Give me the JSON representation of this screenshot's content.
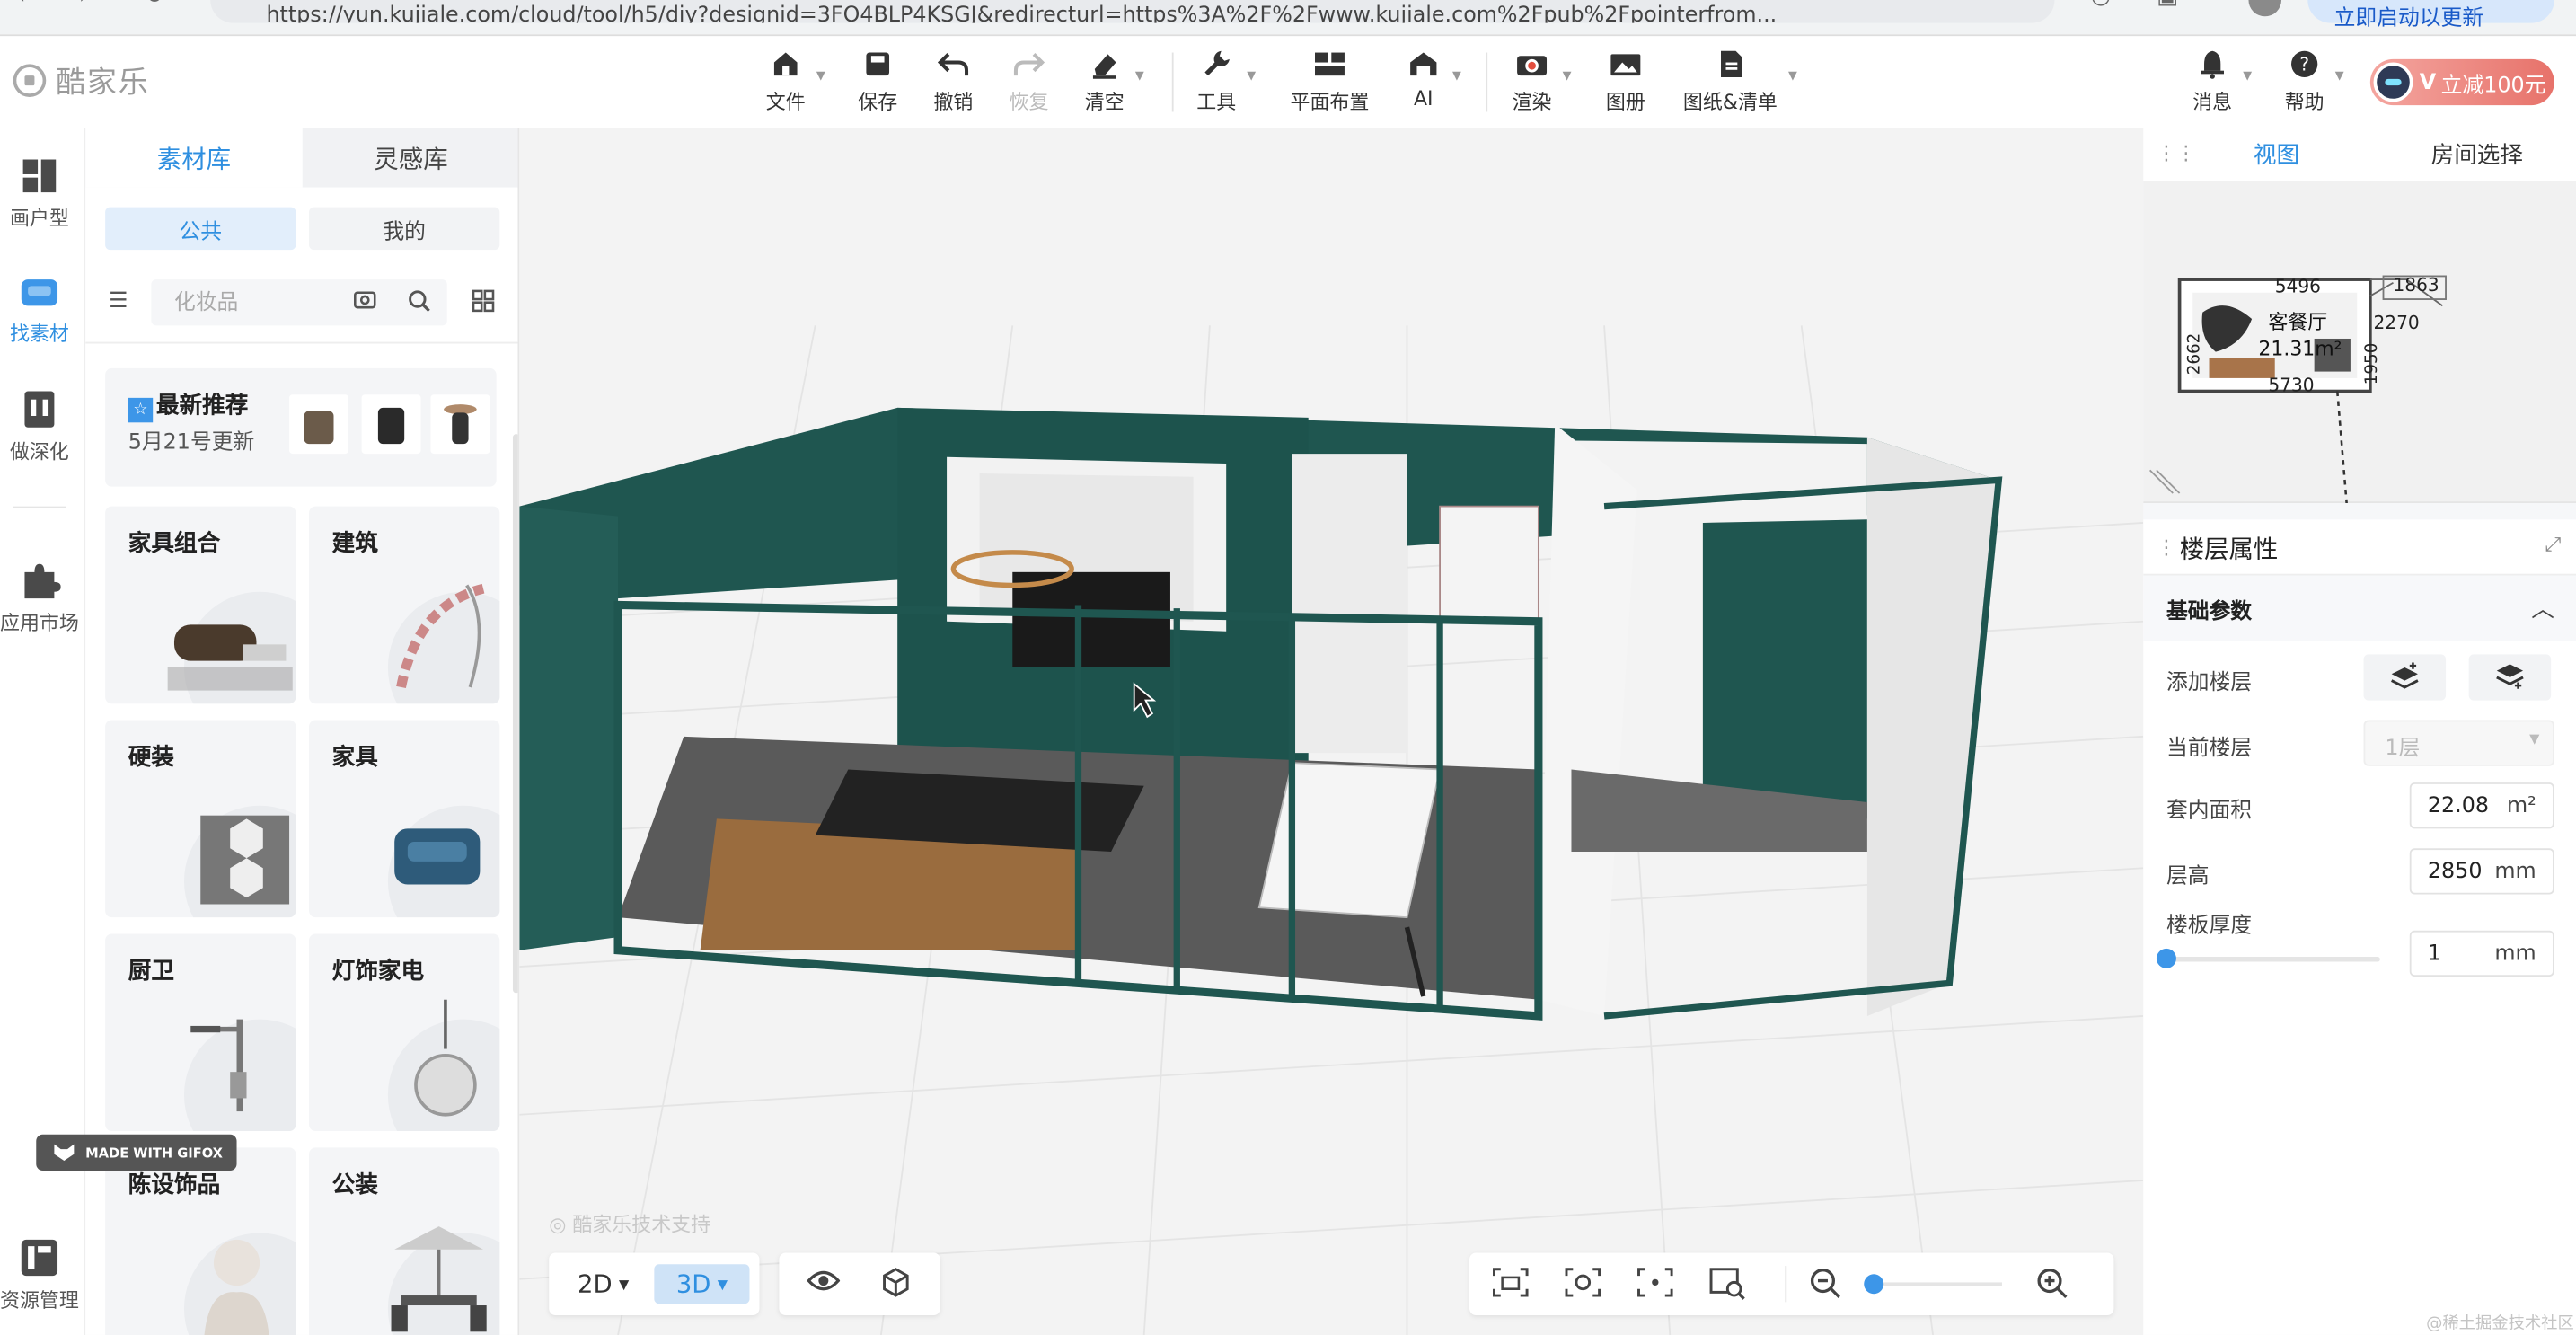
{
  "browser": {
    "url": "https://yun.kujiale.com/cloud/tool/h5/diy?designid=3FO4BLP4KSGJ&redirecturl=https%3A%2F%2Fwww.kujiale.com%2Fpub%2Fpointerfrom...",
    "update_label": "立即启动以更新"
  },
  "app": {
    "logo_text": "酷家乐"
  },
  "toolbar": {
    "file": "文件",
    "save": "保存",
    "undo": "撤销",
    "redo": "恢复",
    "clear": "清空",
    "tools": "工具",
    "layout": "平面布置",
    "ai": "AI",
    "render": "渲染",
    "album": "图册",
    "drawings": "图纸&清单",
    "messages": "消息",
    "help": "帮助",
    "promo": "立减100元"
  },
  "rail": {
    "floorplan": "画户型",
    "materials": "找素材",
    "deepen": "做深化",
    "market": "应用市场",
    "assets": "资源管理"
  },
  "panel": {
    "tab_materials": "素材库",
    "tab_inspiration": "灵感库",
    "seg_public": "公共",
    "seg_mine": "我的",
    "search_placeholder": "化妆品",
    "featured_title": "最新推荐",
    "featured_sub": "5月21号更新",
    "categories": [
      "家具组合",
      "建筑",
      "硬装",
      "家具",
      "厨卫",
      "灯饰家电",
      "陈设饰品",
      "公装"
    ]
  },
  "viewport": {
    "watermark": "酷家乐技术支持",
    "mode_2d": "2D",
    "mode_3d": "3D",
    "gifox": "MADE WITH GIFOX",
    "zoom_level": 0.02
  },
  "right_panel": {
    "tab_view": "视图",
    "tab_room": "房间选择",
    "minimap": {
      "room_name": "客餐厅",
      "room_area": "21.31m²",
      "dim_top": "5496",
      "dim_bottom": "5730",
      "dim_left": "2662",
      "dim_right": "1950",
      "dim_top_right": "1863",
      "dim_right2": "2270"
    },
    "floor_props_title": "楼层属性",
    "basic_params": "基础参数",
    "add_floor": "添加楼层",
    "current_floor": "当前楼层",
    "current_floor_value": "1层",
    "inner_area": "套内面积",
    "inner_area_value": "22.08",
    "inner_area_unit": "m²",
    "floor_height": "层高",
    "floor_height_value": "2850",
    "floor_height_unit": "mm",
    "slab_thickness": "楼板厚度",
    "slab_thickness_value": "1",
    "slab_thickness_unit": "mm"
  },
  "credit": "@稀土掘金技术社区",
  "colors": {
    "accent": "#2f8fe0",
    "wall_green": "#1f5650"
  }
}
